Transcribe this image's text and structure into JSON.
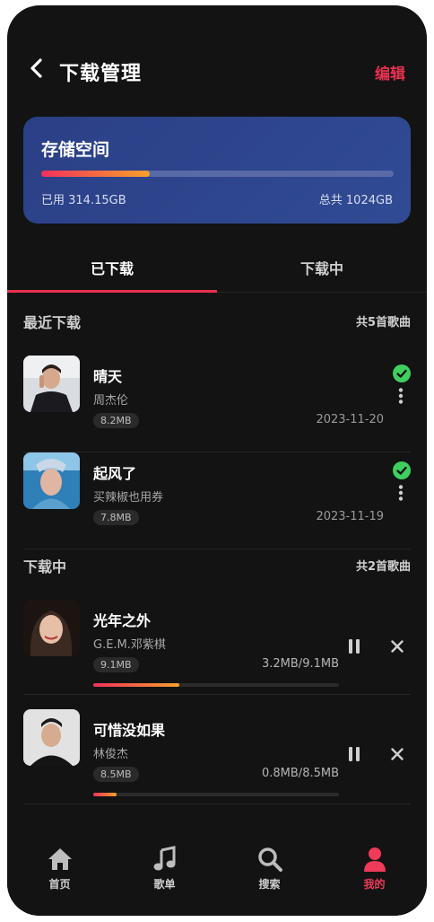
{
  "header": {
    "title": "下载管理",
    "edit_label": "编辑"
  },
  "storage": {
    "title": "存储空间",
    "used_label": "已用 314.15GB",
    "total_label": "总共 1024GB",
    "used_fraction": 0.307,
    "accent": "#e8324f"
  },
  "tabs": [
    {
      "label": "已下载",
      "active": true
    },
    {
      "label": "下载中",
      "active": false
    }
  ],
  "recent": {
    "title": "最近下载",
    "count": "共5首歌曲",
    "items": [
      {
        "title": "晴天",
        "artist": "周杰伦",
        "size": "8.2MB",
        "date": "2023-11-20",
        "status": "check-icon"
      },
      {
        "title": "起风了",
        "artist": "买辣椒也用券",
        "size": "7.8MB",
        "date": "2023-11-19",
        "status": "check-icon"
      }
    ]
  },
  "downloading": {
    "title": "下载中",
    "count": "共2首歌曲",
    "items": [
      {
        "title": "光年之外",
        "artist": "G.E.M.邓紫棋",
        "size": "9.1MB",
        "progress_text": "3.2MB/9.1MB",
        "progress": 0.35
      },
      {
        "title": "可惜没如果",
        "artist": "林俊杰",
        "size": "8.5MB",
        "progress_text": "0.8MB/8.5MB",
        "progress": 0.094
      }
    ]
  },
  "nav": [
    {
      "label": "首页",
      "icon": "home-icon",
      "active": false
    },
    {
      "label": "歌单",
      "icon": "music-note-icon",
      "active": false
    },
    {
      "label": "搜索",
      "icon": "search-icon",
      "active": false
    },
    {
      "label": "我的",
      "icon": "user-icon",
      "active": true
    }
  ]
}
